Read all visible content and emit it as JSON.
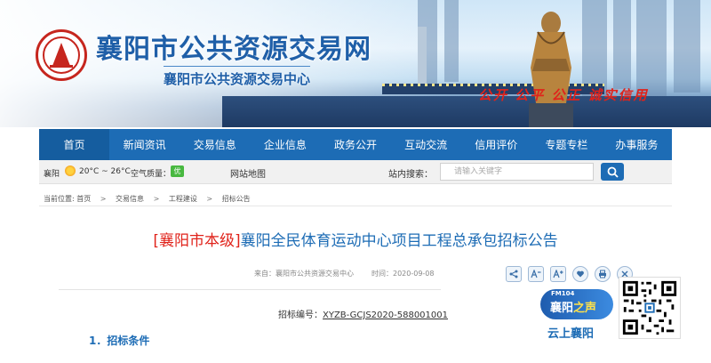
{
  "header": {
    "site_title": "襄阳市公共资源交易网",
    "site_subtitle": "襄阳市公共资源交易中心",
    "slogan": "公开 公平 公正 诚实信用"
  },
  "nav": {
    "items": [
      {
        "label": "首页"
      },
      {
        "label": "新闻资讯"
      },
      {
        "label": "交易信息"
      },
      {
        "label": "企业信息"
      },
      {
        "label": "政务公开"
      },
      {
        "label": "互动交流"
      },
      {
        "label": "信用评价"
      },
      {
        "label": "专题专栏"
      },
      {
        "label": "办事服务"
      }
    ]
  },
  "infobar": {
    "city": "襄阳",
    "temperature": "20°C ~ 26°C",
    "air_quality_label": "空气质量：",
    "air_quality_value": "优",
    "sitemap_label": "网站地图",
    "search_label": "站内搜索：",
    "search_placeholder": "请输入关键字",
    "colors": {
      "nav": "#1d6cb5",
      "aqi_good": "#48b840"
    }
  },
  "breadcrumb": {
    "prefix": "当前位置:",
    "items": [
      "首页",
      "交易信息",
      "工程建设",
      "招标公告"
    ]
  },
  "article": {
    "tag": "[襄阳市本级]",
    "title": "襄阳全民体育运动中心项目工程总承包招标公告",
    "source": "来自：襄阳市公共资源交易中心",
    "date": "时间：2020-09-08",
    "bid_label": "招标编号：",
    "bid_number": "XYZB-GCJS2020-588001001",
    "section_heading": "1．招标条件",
    "tools": [
      "share-icon",
      "font-decrease-icon",
      "font-increase-icon",
      "favorite-icon",
      "print-icon",
      "close-icon"
    ],
    "colors": {
      "title": "#1d6cb5",
      "tag": "#e0231b"
    }
  },
  "radio_ad": {
    "fm": "FM104",
    "name_part1": "襄阳",
    "name_part2": "之声",
    "slogan": "云上襄阳"
  }
}
